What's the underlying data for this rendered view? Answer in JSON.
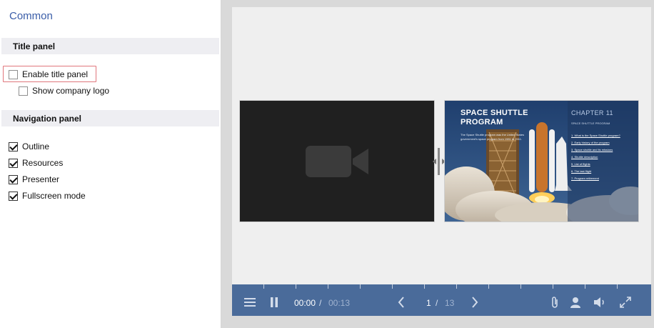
{
  "settings": {
    "title": "Common",
    "title_panel": {
      "header": "Title panel",
      "enable_title_panel": {
        "label": "Enable title panel",
        "checked": false
      },
      "show_company_logo": {
        "label": "Show company logo",
        "checked": false
      }
    },
    "navigation_panel": {
      "header": "Navigation panel",
      "options": [
        {
          "label": "Outline",
          "checked": true
        },
        {
          "label": "Resources",
          "checked": true
        },
        {
          "label": "Presenter",
          "checked": true
        },
        {
          "label": "Fullscreen mode",
          "checked": true
        }
      ]
    }
  },
  "preview": {
    "video_placeholder_icon": "video-camera-icon",
    "slide": {
      "title": "SPACE SHUTTLE PROGRAM",
      "body": "The Space Shuttle program was the United States government's space program from 1981 to 2011.",
      "chapter": "CHAPTER 11",
      "chapter_subtitle": "SPACE SHUTTLE PROGRAM",
      "links": [
        "1. What is the Space Shuttle program?",
        "2. Early history of the program",
        "3. Space shuttle and its missions",
        "4. Shuttle description",
        "5. List of flights",
        "6. The last flight",
        "7. Program retirement"
      ]
    }
  },
  "player": {
    "time_current": "00:00",
    "time_separator": "/",
    "time_total": "00:13",
    "page_current": "1",
    "page_separator": "/",
    "page_total": "13",
    "progress": 0,
    "icons": [
      "menu-icon",
      "pause-icon",
      "prev-icon",
      "next-icon",
      "attachment-icon",
      "presenter-icon",
      "volume-icon",
      "fullscreen-icon"
    ]
  },
  "colors": {
    "accent_title": "#3a5da8",
    "player_bar": "#4a6b9a",
    "highlight_frame": "#e0767c"
  }
}
